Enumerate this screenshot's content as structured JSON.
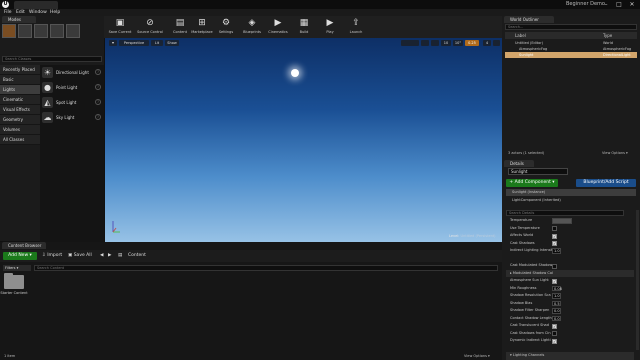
{
  "window": {
    "project_name": "Beginner Demo",
    "minimize": "–",
    "maximize": "□",
    "close": "✕",
    "logo": "U"
  },
  "menu": [
    "File",
    "Edit",
    "Window",
    "Help"
  ],
  "modes": {
    "tab": "Modes",
    "search_placeholder": "Search Classes",
    "categories": [
      "Recently Placed",
      "Basic",
      "Lights",
      "Cinematic",
      "Visual Effects",
      "Geometry",
      "Volumes",
      "All Classes"
    ],
    "active_category": "Lights",
    "items": [
      {
        "label": "Directional Light",
        "icon": "directional-light-icon",
        "glyph": "☀"
      },
      {
        "label": "Point Light",
        "icon": "point-light-icon",
        "glyph": "●"
      },
      {
        "label": "Spot Light",
        "icon": "spot-light-icon",
        "glyph": "◭"
      },
      {
        "label": "Sky Light",
        "icon": "sky-light-icon",
        "glyph": "☁"
      }
    ],
    "help": "?"
  },
  "toolbar": [
    {
      "label": "Save Current",
      "icon": "save-icon",
      "glyph": "▣"
    },
    {
      "label": "Source Control",
      "icon": "source-control-icon",
      "glyph": "⊘"
    },
    {
      "label": "Content",
      "icon": "content-icon",
      "glyph": "▤"
    },
    {
      "label": "Marketplace",
      "icon": "marketplace-icon",
      "glyph": "⊞"
    },
    {
      "label": "Settings",
      "icon": "settings-icon",
      "glyph": "⚙"
    },
    {
      "label": "Blueprints",
      "icon": "blueprints-icon",
      "glyph": "◈"
    },
    {
      "label": "Cinematics",
      "icon": "cinematics-icon",
      "glyph": "▶"
    },
    {
      "label": "Build",
      "icon": "build-icon",
      "glyph": "▦"
    },
    {
      "label": "Play",
      "icon": "play-icon",
      "glyph": "▶"
    },
    {
      "label": "Launch",
      "icon": "launch-icon",
      "glyph": "⇪"
    }
  ],
  "viewport": {
    "menu": "▾",
    "view_mode": "Perspective",
    "lit": "Lit",
    "show": "Show",
    "snap_values": [
      "10",
      "10°",
      "0.25",
      "4"
    ],
    "level_label": "Level:",
    "level_name": "Untitled (Persistent)",
    "colors": {
      "sky_top": "#0d2f66",
      "sky_bottom": "#97c2e6"
    }
  },
  "outliner": {
    "tab": "World Outliner",
    "search_placeholder": "Search...",
    "col_label": "Label",
    "col_type": "Type",
    "rows": [
      {
        "label": "Untitled (Editor)",
        "type": "World",
        "selected": false
      },
      {
        "label": "AtmosphericFog",
        "type": "AtmosphericFog",
        "selected": false
      },
      {
        "label": "Sunlight",
        "type": "DirectionalLight",
        "selected": true
      }
    ],
    "status": "3 actors (1 selected)",
    "view_options": "View Options ▾"
  },
  "details": {
    "tab": "Details",
    "name": "Sunlight",
    "add_component": "+ Add Component ▾",
    "blueprint_script": "Blueprint/Add Script",
    "components": [
      "Sunlight (Instance)",
      "LightComponent (Inherited)"
    ],
    "search_placeholder": "Search Details",
    "properties": [
      {
        "label": "Temperature",
        "kind": "value",
        "value": ""
      },
      {
        "label": "Use Temperature",
        "kind": "check",
        "value": false
      },
      {
        "label": "Affects World",
        "kind": "check",
        "value": true
      },
      {
        "label": "Cast Shadows",
        "kind": "check",
        "value": true
      },
      {
        "label": "Indirect Lighting Intensity",
        "kind": "value",
        "value": "1.0"
      },
      {
        "label": "",
        "kind": "spacer",
        "value": ""
      },
      {
        "label": "Cast Modulated Shadows",
        "kind": "check",
        "value": false
      },
      {
        "label": "▸ Modulated Shadow Col",
        "kind": "section",
        "value": ""
      },
      {
        "label": "Atmosphere Sun Light",
        "kind": "check",
        "value": true
      },
      {
        "label": "Min Roughness",
        "kind": "value",
        "value": "0.08"
      },
      {
        "label": "Shadow Resolution Sca",
        "kind": "value",
        "value": "1.0"
      },
      {
        "label": "Shadow Bias",
        "kind": "value",
        "value": "0.5"
      },
      {
        "label": "Shadow Filter Sharpen",
        "kind": "value",
        "value": "0.0"
      },
      {
        "label": "Contact Shadow Length",
        "kind": "value",
        "value": "0.0"
      },
      {
        "label": "Cast Translucent Shad",
        "kind": "check",
        "value": true
      },
      {
        "label": "Cast Shadows from Cin",
        "kind": "check",
        "value": false
      },
      {
        "label": "Dynamic Indirect Lighti",
        "kind": "check",
        "value": true
      },
      {
        "label": "",
        "kind": "spacer",
        "value": ""
      },
      {
        "label": "▾ Lighting Channels",
        "kind": "section",
        "value": ""
      }
    ]
  },
  "content_browser": {
    "tab": "Content Browser",
    "add_new": "Add New ▾",
    "import": "Import",
    "save_all": "Save All",
    "path": "Content",
    "filters": "Filters ▾",
    "search_placeholder": "Search Content",
    "folders": [
      {
        "label": "Starter Content"
      }
    ],
    "item_count": "1 item",
    "view_options": "View Options ▾"
  }
}
